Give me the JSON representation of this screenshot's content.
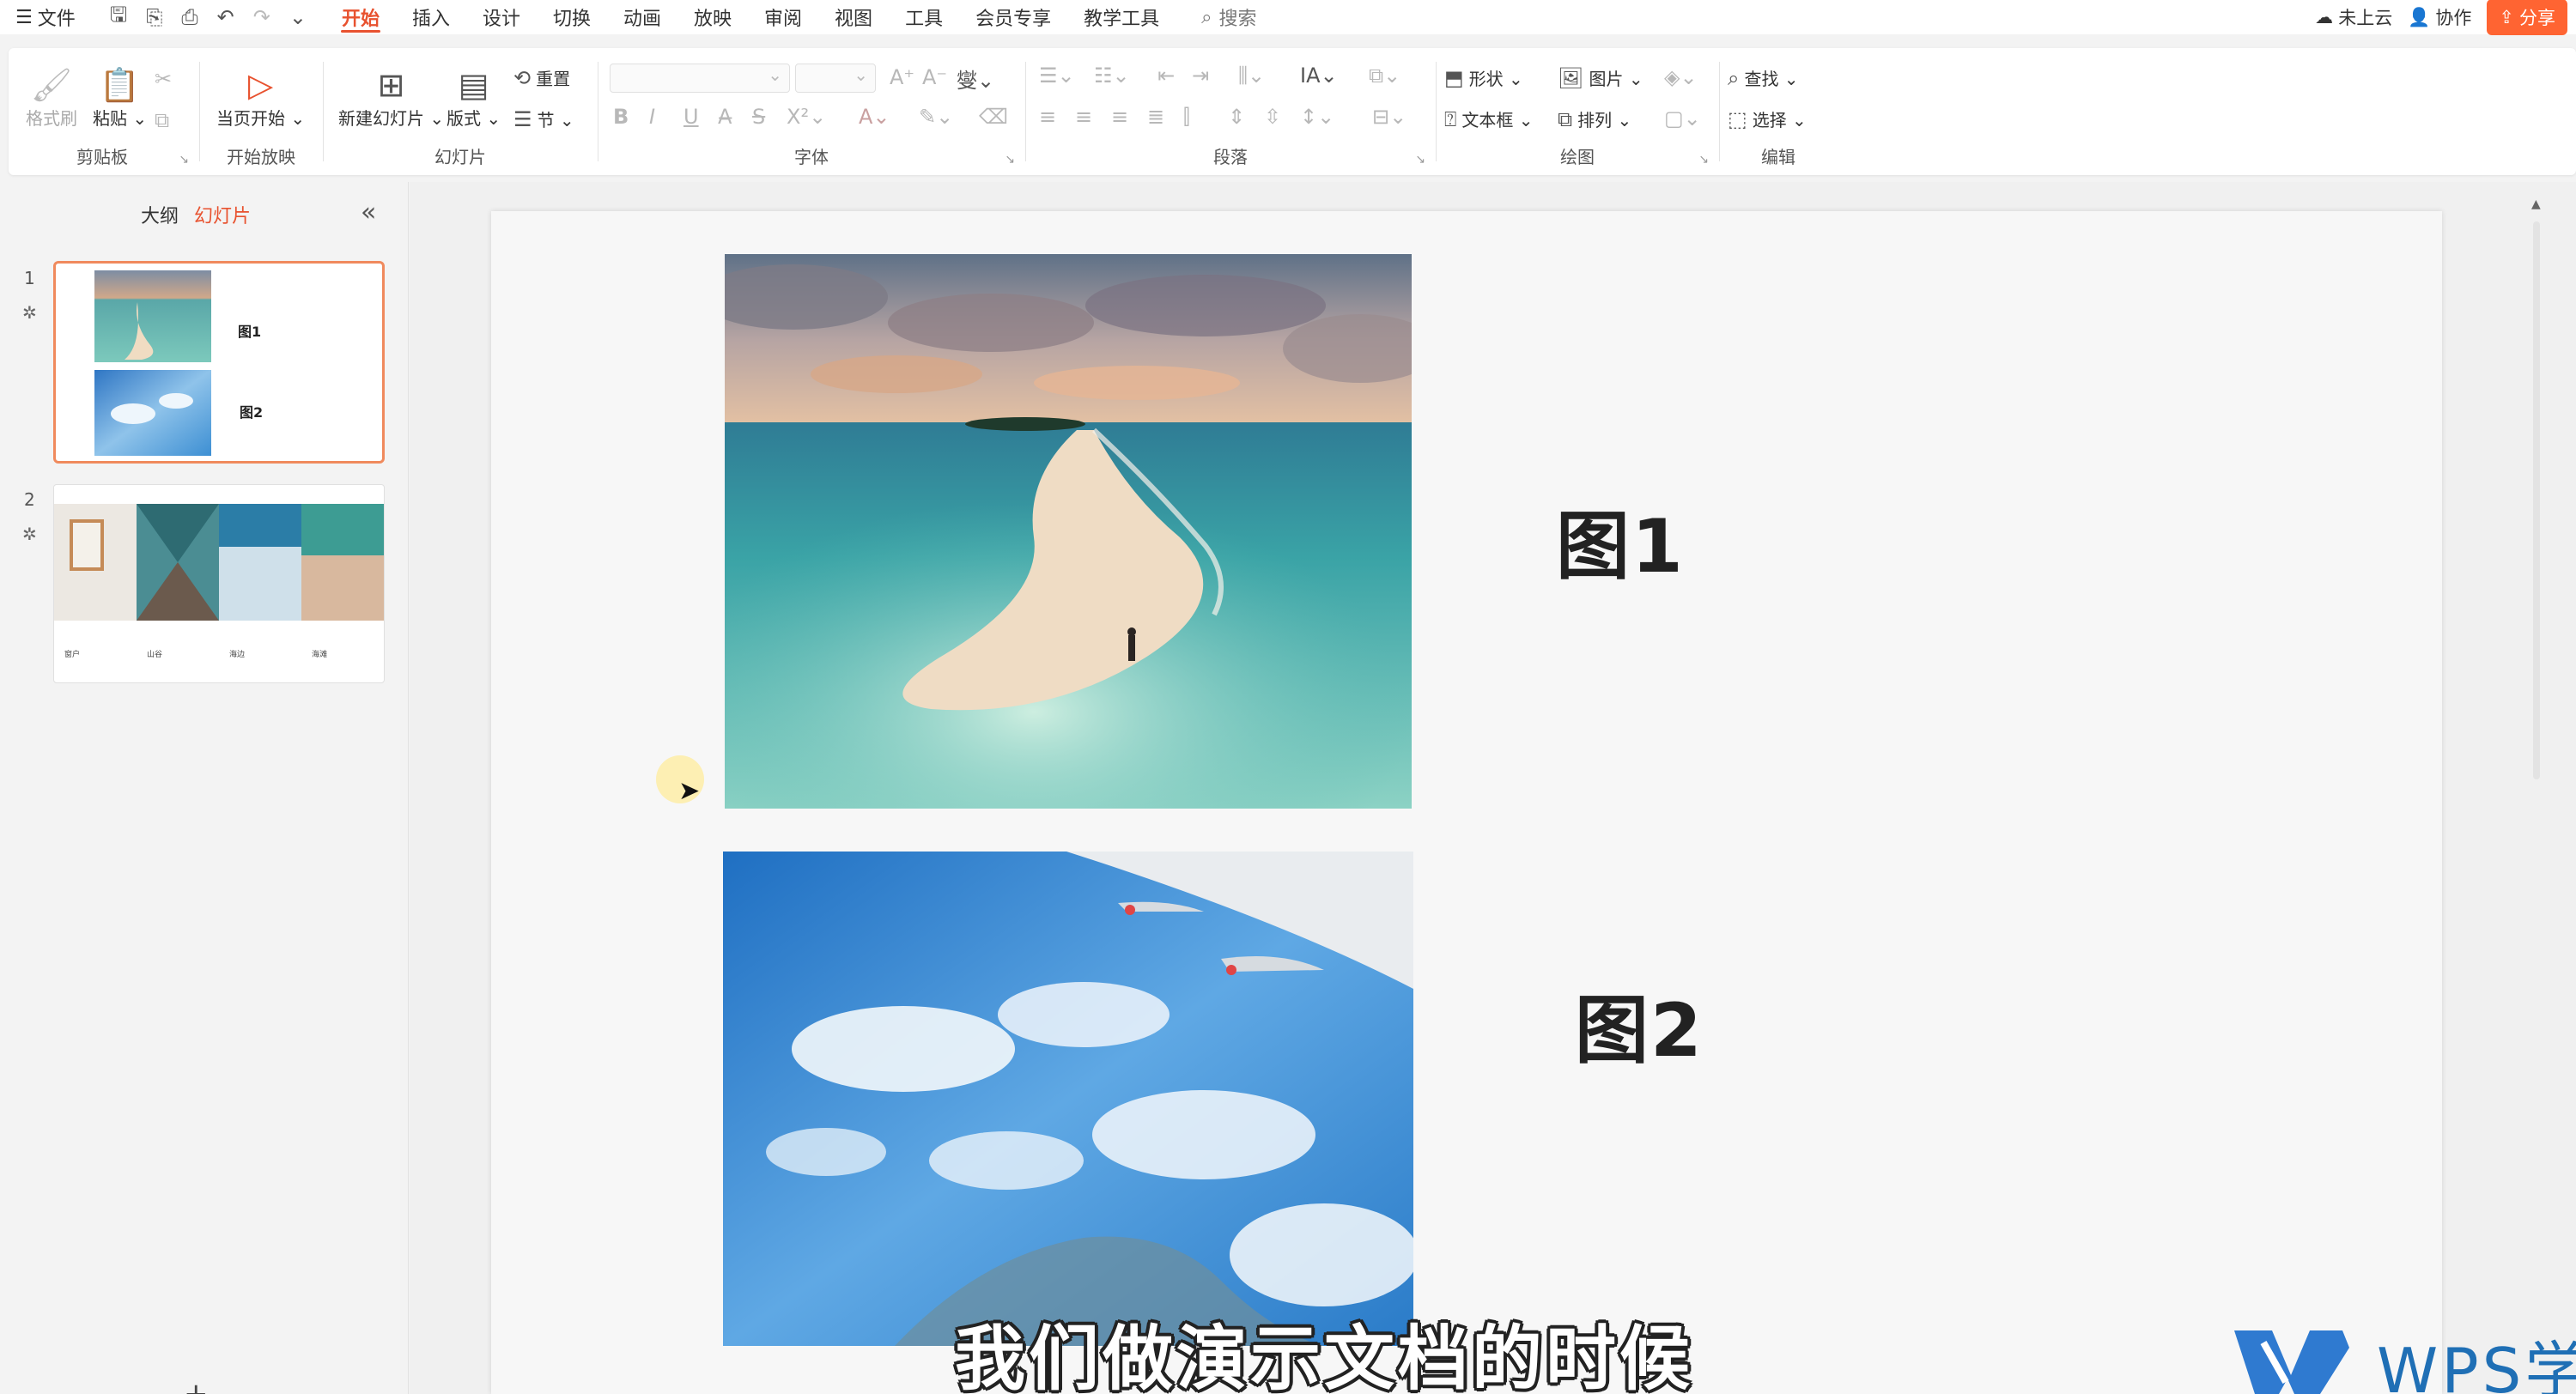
{
  "menubar": {
    "file_label": "文件",
    "tabs": [
      "开始",
      "插入",
      "设计",
      "切换",
      "动画",
      "放映",
      "审阅",
      "视图",
      "工具",
      "会员专享",
      "教学工具"
    ],
    "active_tab_index": 0,
    "search_label": "搜索",
    "cloud_label": "未上云",
    "collab_label": "协作",
    "share_label": "分享"
  },
  "ribbon": {
    "clipboard": {
      "format_painter": "格式刷",
      "paste": "粘贴",
      "group": "剪贴板"
    },
    "slideshow": {
      "from_current": "当页开始",
      "group": "开始放映"
    },
    "slides": {
      "new_slide": "新建幻灯片",
      "layout": "版式",
      "reset": "重置",
      "section": "节",
      "group": "幻灯片"
    },
    "font": {
      "group": "字体"
    },
    "paragraph": {
      "group": "段落"
    },
    "drawing": {
      "shape": "形状",
      "picture": "图片",
      "textbox": "文本框",
      "arrange": "排列",
      "group": "绘图"
    },
    "editing": {
      "find": "查找",
      "select": "选择",
      "group": "编辑"
    }
  },
  "panel": {
    "tab_outline": "大纲",
    "tab_slides": "幻灯片",
    "slides": [
      {
        "number": "1",
        "labels": [
          "图1",
          "图2"
        ]
      },
      {
        "number": "2",
        "captions": [
          "窗户",
          "山谷",
          "海边",
          "海滩"
        ]
      }
    ]
  },
  "slide": {
    "label1": "图1",
    "label2": "图2"
  },
  "subtitle": "我们做演示文档的时候",
  "watermark": "WPS学"
}
